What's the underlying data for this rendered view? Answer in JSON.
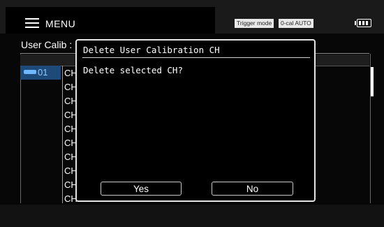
{
  "header": {
    "menu_label": "MENU",
    "trigger_badge": "Trigger mode",
    "ocal_badge": "0-cal AUTO",
    "battery_icon": "battery-icon"
  },
  "page": {
    "title": "User Calib :",
    "selected_row_number": "01",
    "ch_items": [
      "CH",
      "CH",
      "CH",
      "CH",
      "CH",
      "CH",
      "CH",
      "CH",
      "CH",
      "CH"
    ]
  },
  "dialog": {
    "title": "Delete User Calibration CH",
    "message": "Delete selected CH?",
    "yes_label": "Yes",
    "no_label": "No"
  },
  "colors": {
    "accent": "#6fb7ff",
    "selection": "#1e4a7a"
  }
}
